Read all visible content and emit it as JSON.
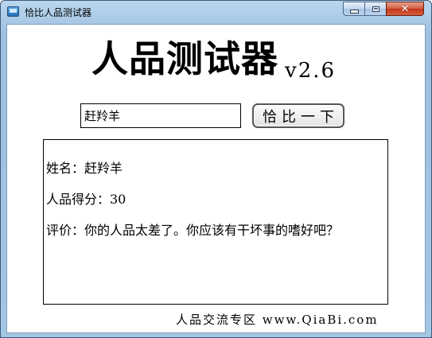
{
  "window": {
    "title": "恰比人品测试器",
    "close_glyph": "✕"
  },
  "app": {
    "title": "人品测试器",
    "version": "v2.6"
  },
  "input": {
    "value": "赶羚羊",
    "placeholder": ""
  },
  "button": {
    "label": "恰比一下"
  },
  "result": {
    "name_line": "姓名：赶羚羊",
    "score_line": "人品得分：30",
    "review_line": "评价：你的人品太差了。你应该有干坏事的嗜好吧？"
  },
  "footer": {
    "text": "人品交流专区 www.QiaBi.com"
  },
  "colors": {
    "titlebar": "#a3c6e3",
    "close_button": "#c1361a",
    "client_background": "#ffffff"
  }
}
